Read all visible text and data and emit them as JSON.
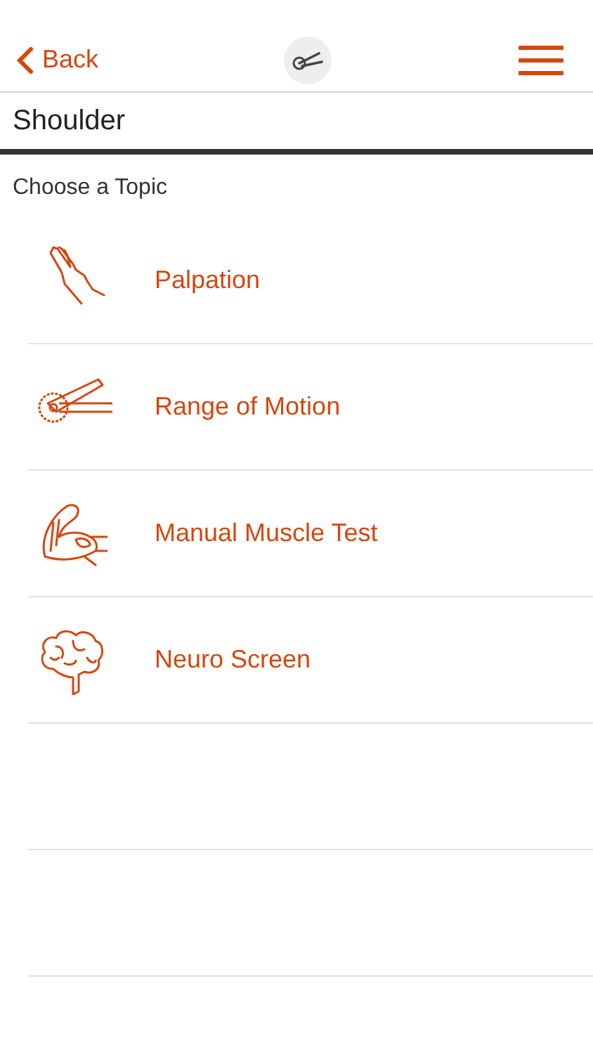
{
  "nav": {
    "back": "Back"
  },
  "title": "Shoulder",
  "subtitle": "Choose a Topic",
  "topics": [
    {
      "label": "Palpation",
      "kind": "hand"
    },
    {
      "label": "Range of Motion",
      "kind": "goniometer"
    },
    {
      "label": "Manual Muscle Test",
      "kind": "muscle"
    },
    {
      "label": "Neuro Screen",
      "kind": "brain"
    }
  ]
}
